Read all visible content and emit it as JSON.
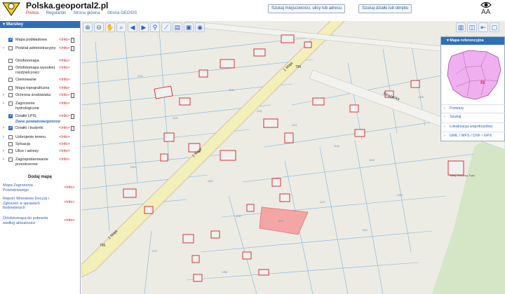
{
  "header": {
    "title": "Polska.geoportal2.pl",
    "links": [
      "Pomoc",
      "Regulamin",
      "Strona główna",
      "Strona GEOSIS"
    ],
    "search_address_button": "Szukaj miejscowości, ulicy lub adresu",
    "search_parcel_button": "Szukaj działki lub obrębu",
    "font_size_label": "AA"
  },
  "layers": {
    "title": "Warstwy",
    "items": [
      {
        "label": "Mapa podkładowa",
        "checked": true,
        "arrow": false,
        "info": "<Info>",
        "doc": true
      },
      {
        "label": "Podział administracyjny",
        "checked": false,
        "arrow": true,
        "info": "<Info>",
        "doc": true
      },
      {
        "label": "Ortofotomapa",
        "checked": false,
        "arrow": false,
        "info": "<Info>",
        "doc": false
      },
      {
        "label": "Ortofotomapa wysokiej rozdzielczości",
        "checked": false,
        "arrow": false,
        "info": "<Info>",
        "doc": false
      },
      {
        "label": "Cieniowanie",
        "checked": false,
        "arrow": false,
        "info": "<Info>",
        "doc": false
      },
      {
        "label": "Mapa topograficzna",
        "checked": false,
        "arrow": false,
        "info": "<Info>",
        "doc": false
      },
      {
        "label": "Ochrona środowiska",
        "checked": false,
        "arrow": true,
        "info": "<Info>",
        "doc": true
      },
      {
        "label": "Zagrożenie hydrologiczne",
        "checked": false,
        "arrow": true,
        "info": "<Info>",
        "doc": false
      },
      {
        "label": "Działki LPIS",
        "checked": true,
        "arrow": false,
        "info": "<Info>",
        "doc": true
      }
    ],
    "section_label": "Dane powiatowe/gminne",
    "items2": [
      {
        "label": "Działki i budynki",
        "checked": true,
        "arrow": true,
        "info": "<Info>",
        "doc": true
      },
      {
        "label": "Uzbrojenie terenu",
        "checked": false,
        "arrow": true,
        "info": "<Info>",
        "doc": false
      },
      {
        "label": "Sytuacja",
        "checked": false,
        "arrow": false,
        "info": "<Info>",
        "doc": false
      },
      {
        "label": "Ulice i adresy",
        "checked": false,
        "arrow": true,
        "info": "<Info>",
        "doc": false
      },
      {
        "label": "Zagospodarowanie przestrzenne",
        "checked": false,
        "arrow": true,
        "info": "<Info>",
        "doc": false
      }
    ],
    "add_map_label": "Dodaj mapę",
    "extra_maps": [
      {
        "label": "Mapa Zagrożenia Powodziowego",
        "info": "<Info>"
      },
      {
        "label": "Rejestr Wniosków Decyzji i Zgłoszeń w sprawach budowlanych",
        "info": "<Info>"
      },
      {
        "label": "Ortofotomapa do pobrania według aktualności",
        "info": "<Info>"
      }
    ]
  },
  "toolbar": {
    "icons": [
      "zoom-in-icon",
      "zoom-out-icon",
      "pan-hand-icon",
      "zoom-box-icon",
      "back-arrow-icon",
      "forward-arrow-icon",
      "link-icon",
      "measure-icon",
      "print-icon",
      "camera-icon",
      "globe-icon"
    ]
  },
  "reference_panel": {
    "title": "Mapa referencyjna",
    "items": [
      "Pomiary",
      "Szukaj",
      "Lokalizacja współrzędnej",
      "GML / WFS / DXF / GPX"
    ]
  },
  "map": {
    "street_labels": [
      "1 Maja",
      "1 Maja",
      "1 Maja",
      "Strażacka"
    ],
    "road_numbers": [
      "796",
      "796"
    ],
    "place_label": "Sklep Rolniczy Tusz",
    "parcel_numbers": [
      "1123",
      "1128",
      "1135",
      "1102",
      "1141",
      "1148",
      "1155",
      "1167",
      "1180",
      "1190",
      "1197",
      "1210",
      "1262",
      "1275",
      "1288",
      "1340",
      "1345"
    ]
  },
  "colors": {
    "accent": "#2f6fb8",
    "info": "#cc2222",
    "parcel_highlight": "#f4a6a6",
    "road_fill": "#f3efb8"
  }
}
